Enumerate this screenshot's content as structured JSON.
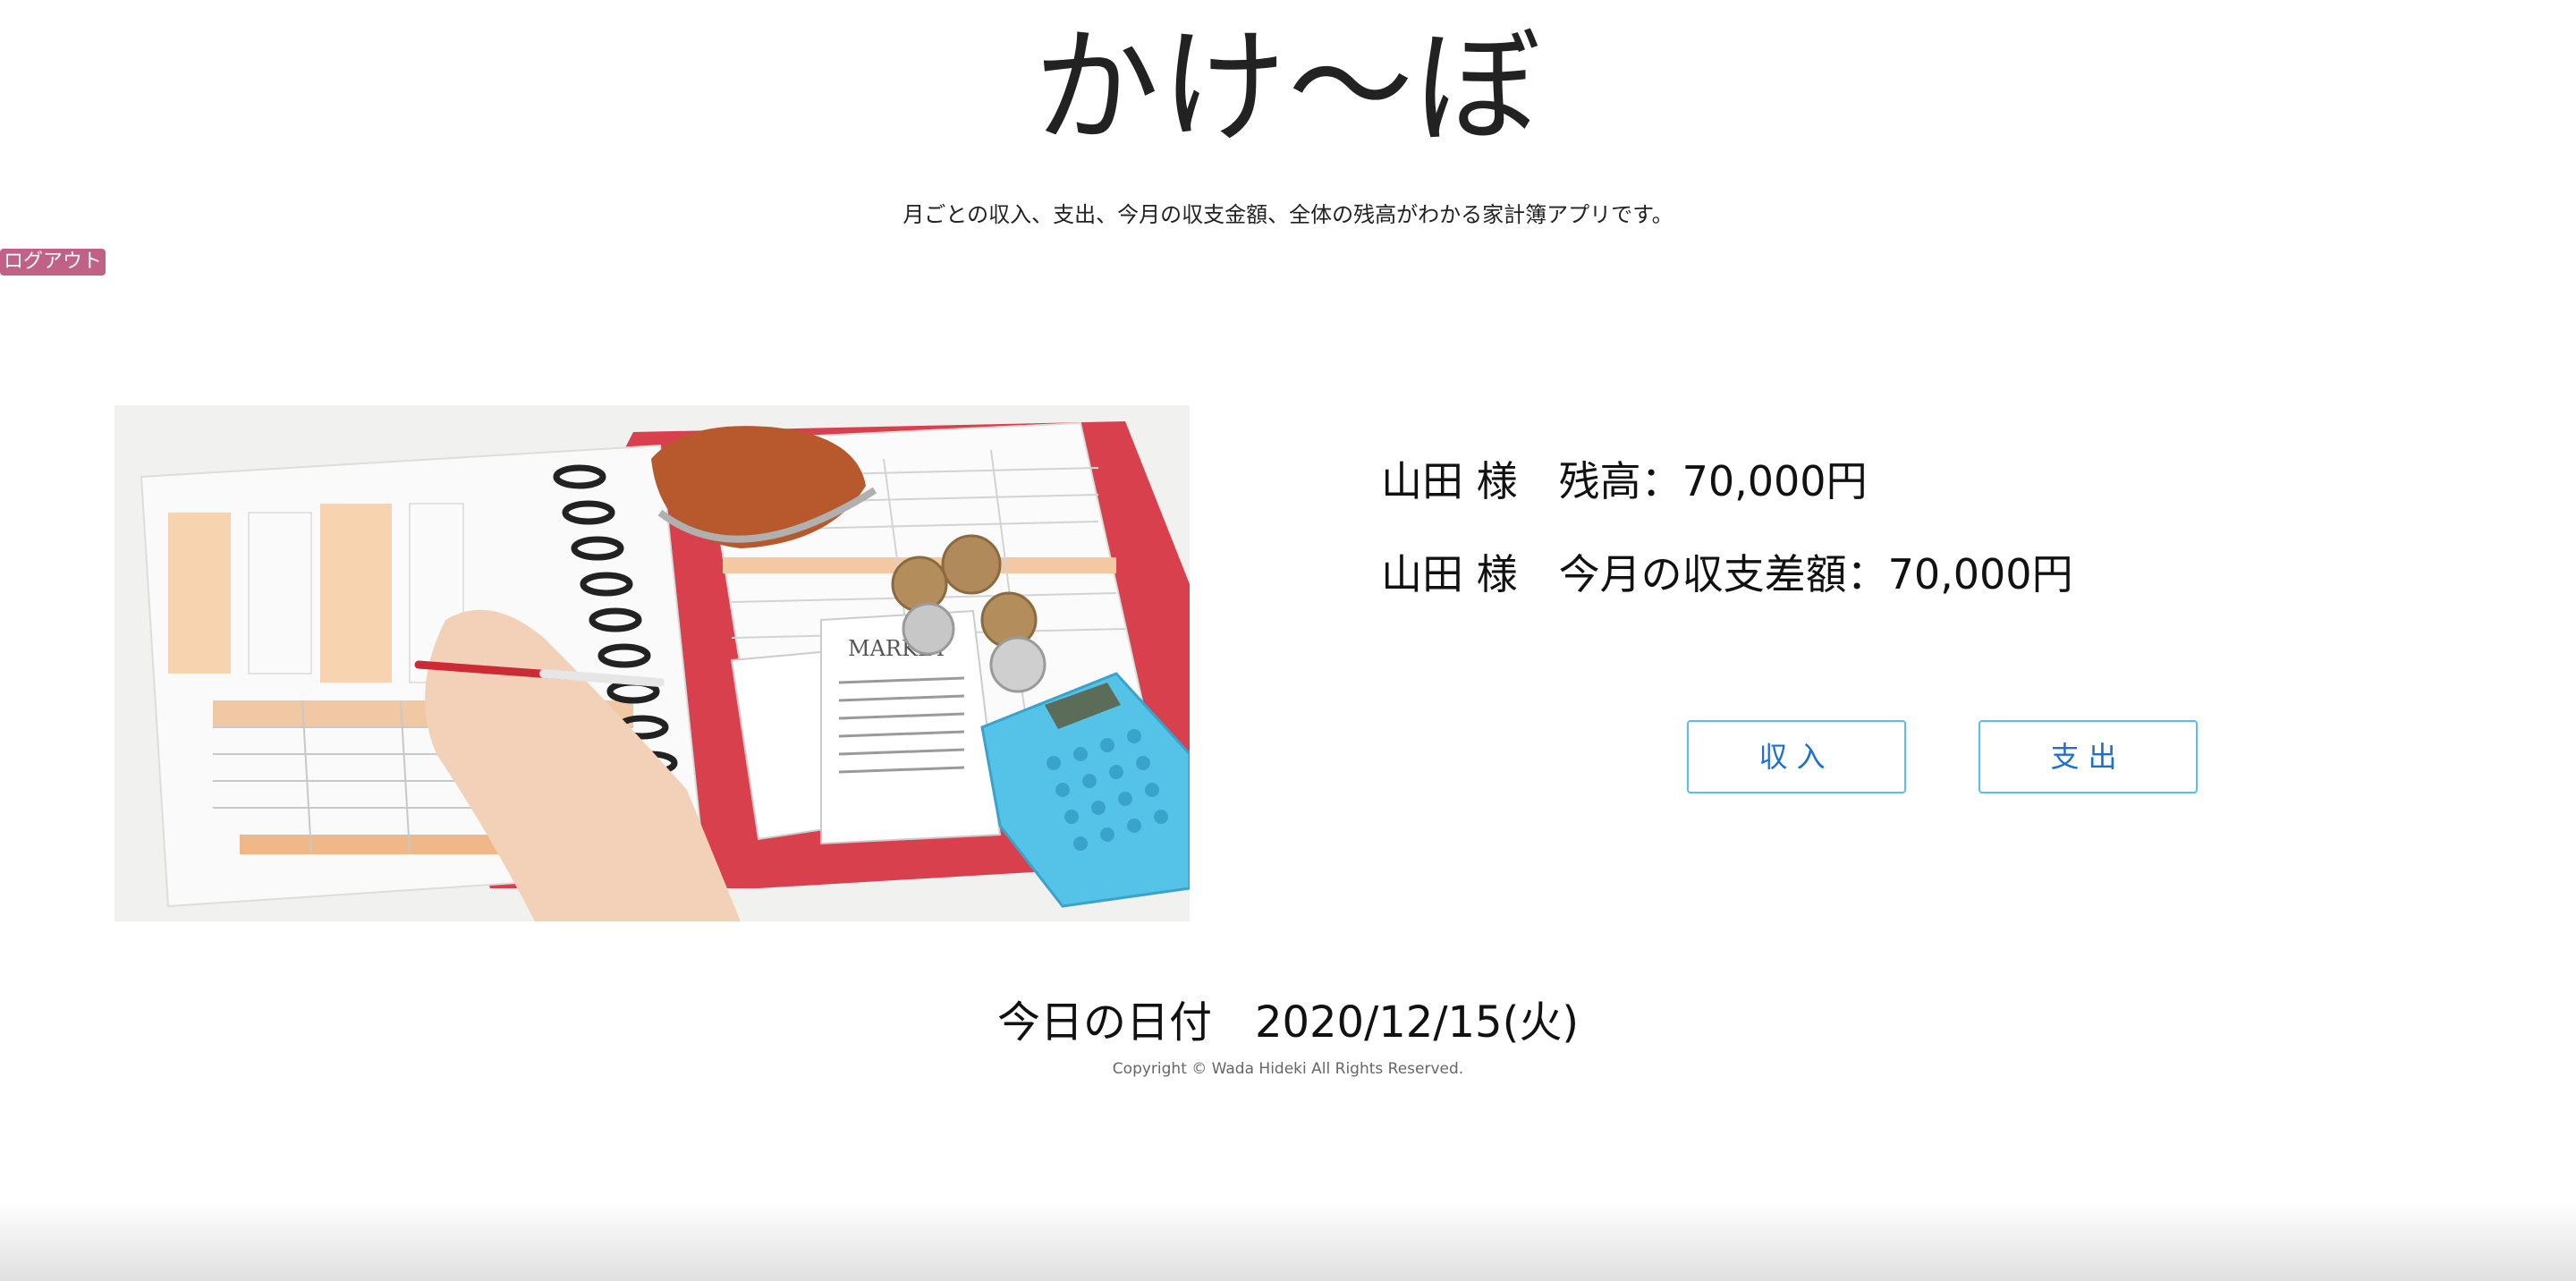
{
  "app": {
    "title": "かけ〜ぼ",
    "subtitle": "月ごとの収入、支出、今月の収支金額、全体の残高がわかる家計簿アプリです。"
  },
  "auth": {
    "logout_label": "ログアウト"
  },
  "hero": {
    "image": "household-account-book-photo"
  },
  "summary": {
    "balance_line": "山田 様　残高：70,000円",
    "monthly_line": "山田 様　今月の収支差額：70,000円"
  },
  "actions": {
    "income_label": "収入",
    "expense_label": "支出"
  },
  "footer": {
    "today": "今日の日付　2020/12/15(火)",
    "copyright": "Copyright © Wada Hideki All Rights Reserved."
  },
  "colors": {
    "logout_bg": "#c06185",
    "button_border": "#5bbcf0",
    "button_text": "#1e6fd0"
  }
}
